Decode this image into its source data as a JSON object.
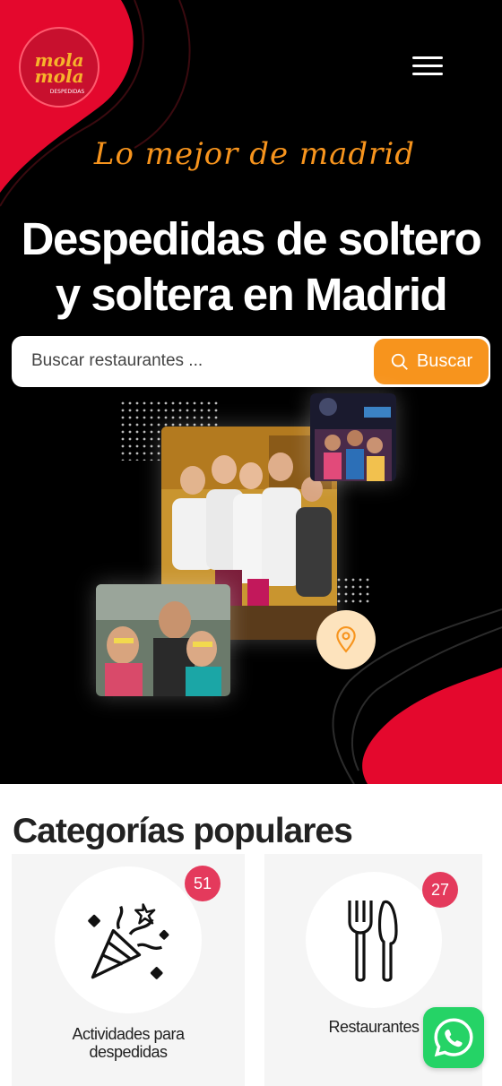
{
  "header": {
    "logo_text_line1": "mola",
    "logo_text_line2": "mola",
    "logo_subtext": "DESPEDIDAS",
    "menu_icon": "hamburger-menu-icon"
  },
  "hero": {
    "tagline": "Lo mejor de madrid",
    "title_line1": "Despedidas de soltero",
    "title_line2": "y soltera en Madrid"
  },
  "search": {
    "placeholder": "Buscar restaurantes ...",
    "button_label": "Buscar",
    "button_icon": "search-icon"
  },
  "colors": {
    "accent_orange": "#f7941d",
    "brand_red": "#e4082d",
    "badge_pink": "#e43a5c",
    "whatsapp_green": "#25d366"
  },
  "categories": {
    "title": "Categorías populares",
    "items": [
      {
        "label": "Actividades para despedidas",
        "count": "51",
        "icon": "party-popper-icon"
      },
      {
        "label": "Restaurantes",
        "count": "27",
        "icon": "fork-knife-icon"
      }
    ]
  },
  "whatsapp": {
    "icon": "whatsapp-icon"
  }
}
